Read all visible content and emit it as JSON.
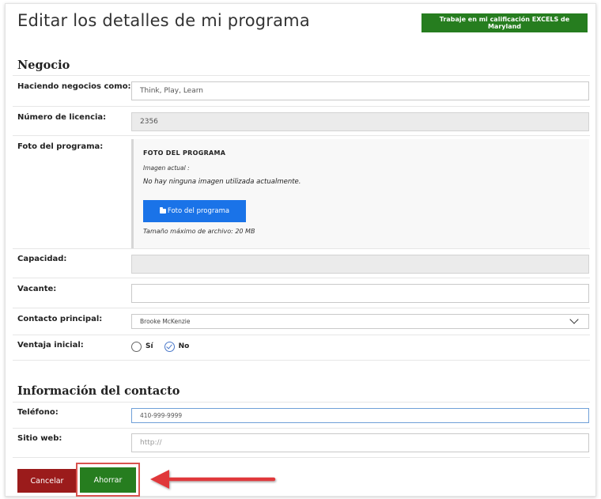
{
  "page": {
    "title": "Editar los detalles de mi programa",
    "excels_button": "Trabaje en mi calificación EXCELS de Maryland"
  },
  "business": {
    "section_title": "Negocio",
    "dba_label": "Haciendo negocios como:",
    "dba_value": "Think, Play, Learn",
    "license_label": "Número de licencia:",
    "license_value": "2356",
    "photo_label": "Foto del programa:",
    "photo_title": "FOTO DEL PROGRAMA",
    "photo_current_label": "Imagen actual :",
    "photo_none_text": "No hay ninguna imagen utilizada actualmente.",
    "photo_button": "Foto del programa",
    "photo_max_size": "Tamaño máximo de archivo: 20 MB",
    "capacity_label": "Capacidad:",
    "capacity_value": "",
    "vacancy_label": "Vacante:",
    "vacancy_value": "",
    "primary_contact_label": "Contacto principal:",
    "primary_contact_value": "Brooke McKenzie",
    "head_start_label": "Ventaja inicial:",
    "head_start_options": [
      "Sí",
      "No"
    ],
    "head_start_selected": "No"
  },
  "contact": {
    "section_title": "Información del contacto",
    "phone_label": "Teléfono:",
    "phone_value": "410-999-9999",
    "website_label": "Sitio web:",
    "website_placeholder": "http://"
  },
  "actions": {
    "cancel_label": "Cancelar",
    "save_label": "Ahorrar"
  },
  "colors": {
    "green": "#267d1f",
    "red": "#9b1b1b",
    "blue": "#1a73e8",
    "highlight": "#d9534f"
  }
}
